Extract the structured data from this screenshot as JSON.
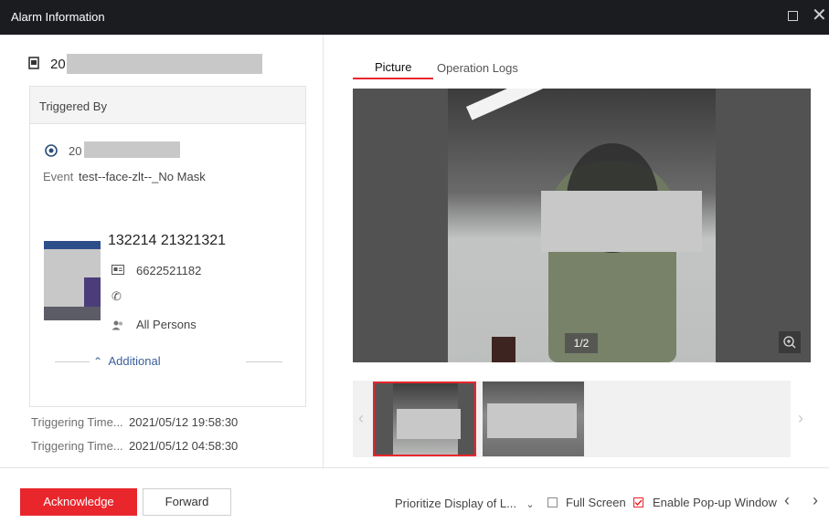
{
  "window": {
    "title": "Alarm Information"
  },
  "left": {
    "header_id_prefix": "20",
    "triggered_by_label": "Triggered By",
    "source_id_prefix": "20",
    "event_label": "Event",
    "event_value": "test--face-zlt--_No Mask",
    "person": {
      "name": "132214 21321321",
      "card_no": "6622521182",
      "group": "All Persons"
    },
    "additional_label": "Additional",
    "triggering_times": [
      {
        "label": "Triggering Time...",
        "value": "2021/05/12 19:58:30"
      },
      {
        "label": "Triggering Time...",
        "value": "2021/05/12 04:58:30"
      }
    ]
  },
  "right": {
    "tabs": [
      "Picture",
      "Operation Logs"
    ],
    "active_tab": "Picture",
    "page_counter": "1/2"
  },
  "footer": {
    "acknowledge_label": "Acknowledge",
    "forward_label": "Forward",
    "prioritize_label": "Prioritize Display of L...",
    "full_screen_label": "Full Screen",
    "full_screen_checked": false,
    "popup_label": "Enable Pop-up Window",
    "popup_checked": true
  },
  "colors": {
    "accent": "#e8262c",
    "title_bar": "#1b1c20"
  }
}
